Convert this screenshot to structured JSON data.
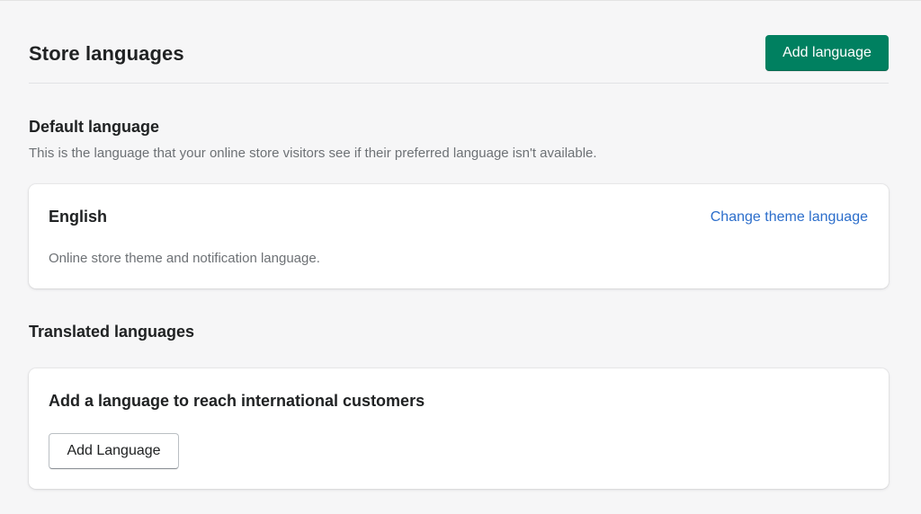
{
  "header": {
    "title": "Store languages",
    "add_button_label": "Add language"
  },
  "default_language": {
    "heading": "Default language",
    "description": "This is the language that your online store visitors see if their preferred language isn't available.",
    "card": {
      "language": "English",
      "change_link": "Change theme language",
      "note": "Online store theme and notification language."
    }
  },
  "translated_languages": {
    "heading": "Translated languages",
    "card": {
      "title": "Add a language to reach international customers",
      "button_label": "Add Language"
    }
  },
  "colors": {
    "primary": "#008060",
    "link": "#2c6ecb",
    "background": "#f6f6f7"
  }
}
